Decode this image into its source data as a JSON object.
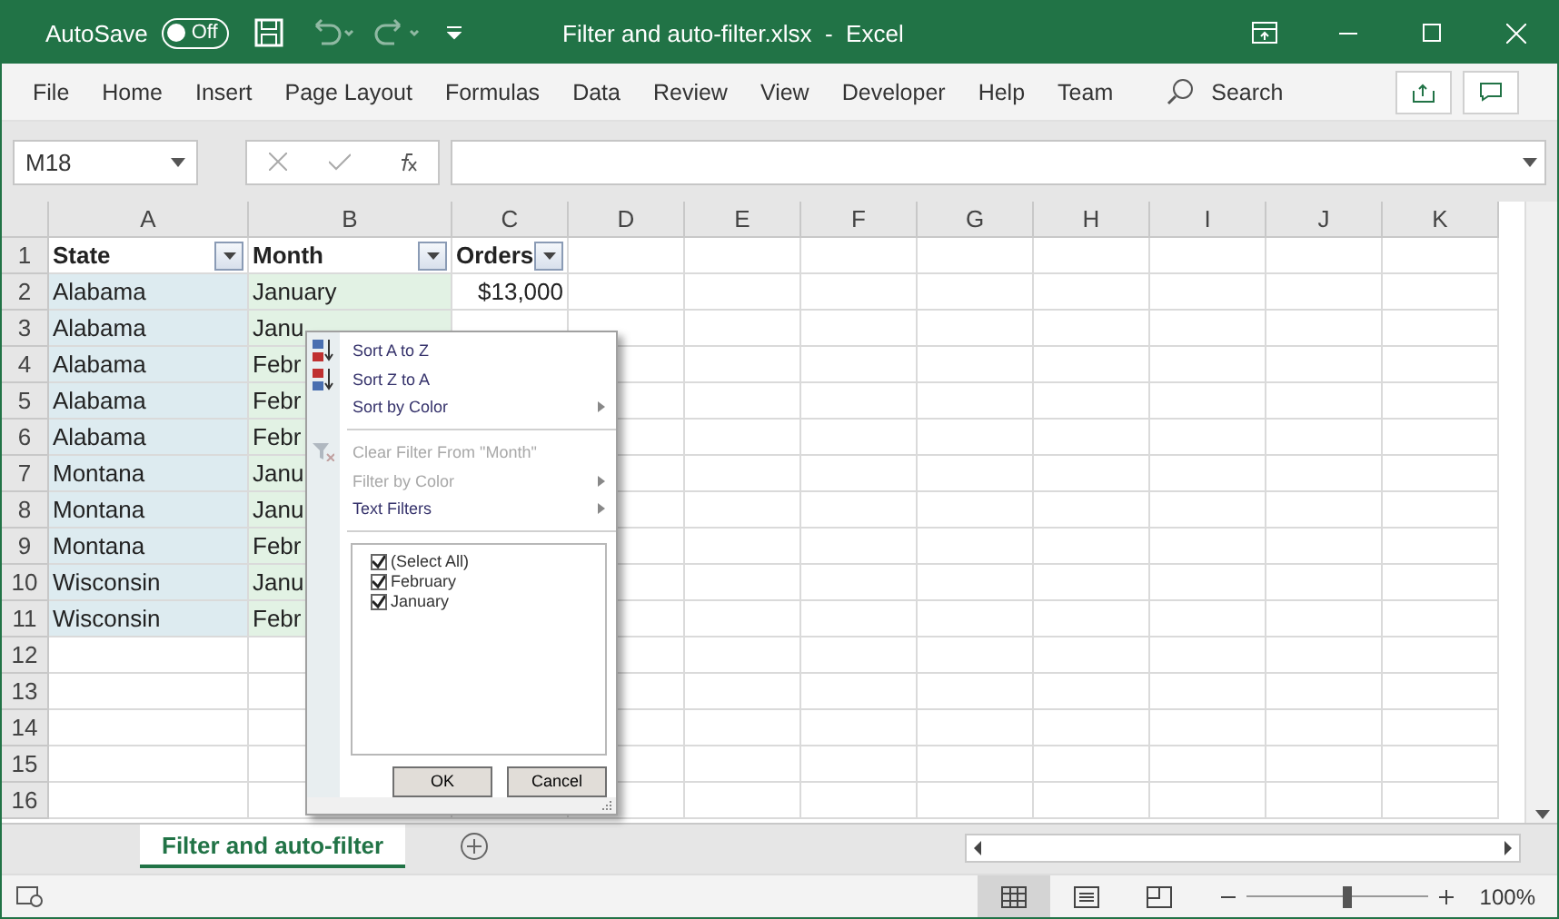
{
  "title_bar": {
    "autosave_label": "AutoSave",
    "autosave_toggle": {
      "label": "Off",
      "on": false
    },
    "title": "Filter and auto-filter.xlsx  -  Excel"
  },
  "ribbon_tabs": [
    {
      "label": "File",
      "selected": false
    },
    {
      "label": "Home",
      "selected": false
    },
    {
      "label": "Insert",
      "selected": false
    },
    {
      "label": "Page Layout",
      "selected": false
    },
    {
      "label": "Formulas",
      "selected": false
    },
    {
      "label": "Data",
      "selected": false
    },
    {
      "label": "Review",
      "selected": false
    },
    {
      "label": "View",
      "selected": false
    },
    {
      "label": "Developer",
      "selected": false
    },
    {
      "label": "Help",
      "selected": false
    },
    {
      "label": "Team",
      "selected": false
    }
  ],
  "search": {
    "label": "Search"
  },
  "formula_bar": {
    "name_box": "M18"
  },
  "columns": [
    "A",
    "B",
    "C",
    "D",
    "E",
    "F",
    "G",
    "H",
    "I",
    "J",
    "K"
  ],
  "rows": [
    {
      "header": "1",
      "cells": [
        {
          "text": "State",
          "kind": "header"
        },
        {
          "text": "Month",
          "kind": "header"
        },
        {
          "text": "Orders",
          "kind": "header"
        }
      ]
    },
    {
      "header": "2",
      "cells": [
        {
          "text": "Alabama",
          "color": "#ddebf0"
        },
        {
          "text": "January",
          "color": "#e2f2e4"
        },
        {
          "text": "$13,000",
          "kind": "number"
        }
      ]
    },
    {
      "header": "3",
      "cells": [
        {
          "text": "Alabama",
          "color": "#ddebf0"
        },
        {
          "text": "Janu",
          "color": "#e2f2e4"
        }
      ]
    },
    {
      "header": "4",
      "cells": [
        {
          "text": "Alabama",
          "color": "#ddebf0"
        },
        {
          "text": "Febr",
          "color": "#e2f2e4"
        }
      ]
    },
    {
      "header": "5",
      "cells": [
        {
          "text": "Alabama",
          "color": "#ddebf0"
        },
        {
          "text": "Febr",
          "color": "#e2f2e4"
        }
      ]
    },
    {
      "header": "6",
      "cells": [
        {
          "text": "Alabama",
          "color": "#ddebf0"
        },
        {
          "text": "Febr",
          "color": "#e2f2e4"
        }
      ]
    },
    {
      "header": "7",
      "cells": [
        {
          "text": "Montana",
          "color": "#ddebf0"
        },
        {
          "text": "Janu",
          "color": "#e2f2e4"
        }
      ]
    },
    {
      "header": "8",
      "cells": [
        {
          "text": "Montana",
          "color": "#ddebf0"
        },
        {
          "text": "Janu",
          "color": "#e2f2e4"
        }
      ]
    },
    {
      "header": "9",
      "cells": [
        {
          "text": "Montana",
          "color": "#ddebf0"
        },
        {
          "text": "Febr",
          "color": "#e2f2e4"
        }
      ]
    },
    {
      "header": "10",
      "cells": [
        {
          "text": "Wisconsin",
          "color": "#ddebf0"
        },
        {
          "text": "Janu",
          "color": "#e2f2e4"
        }
      ]
    },
    {
      "header": "11",
      "cells": [
        {
          "text": "Wisconsin",
          "color": "#ddebf0"
        },
        {
          "text": "Febr",
          "color": "#e2f2e4"
        }
      ]
    },
    {
      "header": "12",
      "cells": []
    },
    {
      "header": "13",
      "cells": []
    },
    {
      "header": "14",
      "cells": []
    },
    {
      "header": "15",
      "cells": []
    },
    {
      "header": "16",
      "cells": []
    }
  ],
  "filter_menu": {
    "items": [
      {
        "kind": "sort-asc",
        "label": "Sort A to Z",
        "disabled": false,
        "submenu": false
      },
      {
        "kind": "sort-desc",
        "label": "Sort Z to A",
        "disabled": false,
        "submenu": false
      },
      {
        "kind": "plain",
        "label": "Sort by Color",
        "disabled": false,
        "submenu": true
      },
      {
        "kind": "separator"
      },
      {
        "kind": "clear",
        "label": "Clear Filter From \"Month\"",
        "disabled": true,
        "submenu": false
      },
      {
        "kind": "plain",
        "label": "Filter by Color",
        "disabled": true,
        "submenu": true
      },
      {
        "kind": "plain",
        "label": "Text Filters",
        "disabled": false,
        "submenu": true
      },
      {
        "kind": "separator"
      }
    ],
    "values": [
      {
        "label": "(Select All)",
        "checked": true
      },
      {
        "label": "February",
        "checked": true
      },
      {
        "label": "January",
        "checked": true
      }
    ],
    "buttons": [
      "OK",
      "Cancel"
    ]
  },
  "sheet_tabs": [
    {
      "label": "Filter and auto-filter",
      "selected": true
    }
  ],
  "status_bar": {
    "views": [
      {
        "kind": "normal",
        "selected": true
      },
      {
        "kind": "page-layout",
        "selected": false
      },
      {
        "kind": "page-break",
        "selected": false
      }
    ],
    "zoom": {
      "level": 0.55,
      "reading": "100%"
    }
  }
}
